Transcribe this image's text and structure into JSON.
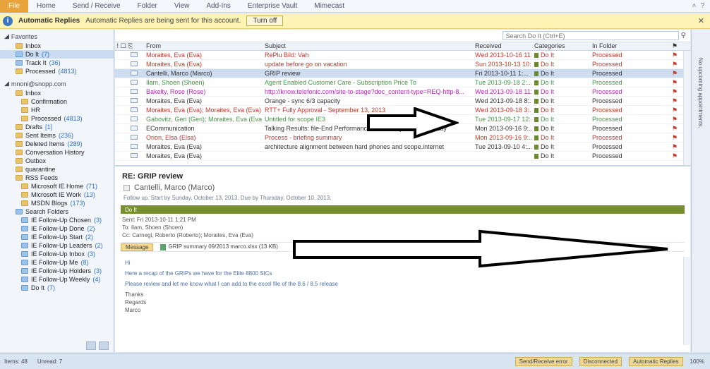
{
  "ribbon": {
    "file": "File",
    "tabs": [
      "Home",
      "Send / Receive",
      "Folder",
      "View",
      "Add-Ins",
      "Enterprise Vault",
      "Mimecast"
    ]
  },
  "notice": {
    "title": "Automatic Replies",
    "text": "Automatic Replies are being sent for this account.",
    "button": "Turn off"
  },
  "nav": {
    "favorites_header": "Favorites",
    "favorites": [
      {
        "label": "Inbox",
        "count": ""
      },
      {
        "label": "Do It",
        "count": "(7)"
      },
      {
        "label": "Track It",
        "count": "(36)"
      },
      {
        "label": "Processed",
        "count": "(4813)"
      }
    ],
    "account_header": "mnoni@snopp.com",
    "account_items": [
      {
        "label": "Inbox",
        "count": "",
        "level": 1
      },
      {
        "label": "Confirmation",
        "count": "",
        "level": 2
      },
      {
        "label": "HR",
        "count": "",
        "level": 2
      },
      {
        "label": "Processed",
        "count": "(4813)",
        "level": 2
      },
      {
        "label": "Drafts",
        "count": "[1]",
        "level": 1
      },
      {
        "label": "Sent Items",
        "count": "(236)",
        "level": 1
      },
      {
        "label": "Deleted Items",
        "count": "(289)",
        "level": 1
      },
      {
        "label": "Conversation History",
        "count": "",
        "level": 1
      },
      {
        "label": "Outbox",
        "count": "",
        "level": 1
      },
      {
        "label": "quarantine",
        "count": "",
        "level": 1
      },
      {
        "label": "RSS Feeds",
        "count": "",
        "level": 1
      },
      {
        "label": "Microsoft IE Home",
        "count": "(71)",
        "level": 2
      },
      {
        "label": "Microsoft IE Work",
        "count": "(13)",
        "level": 2
      },
      {
        "label": "MSDN Blogs",
        "count": "(173)",
        "level": 2
      },
      {
        "label": "Search Folders",
        "count": "",
        "level": 1
      },
      {
        "label": "IE Follow-Up Chosen",
        "count": "(3)",
        "level": 2
      },
      {
        "label": "IE Follow-Up Done",
        "count": "(2)",
        "level": 2
      },
      {
        "label": "IE Follow-Up Start",
        "count": "(2)",
        "level": 2
      },
      {
        "label": "IE Follow-Up Leaders",
        "count": "(2)",
        "level": 2
      },
      {
        "label": "IE Follow-Up Inbox",
        "count": "(3)",
        "level": 2
      },
      {
        "label": "IE Follow-Up Me",
        "count": "(8)",
        "level": 2
      },
      {
        "label": "IE Follow-Up Holders",
        "count": "(3)",
        "level": 2
      },
      {
        "label": "IE Follow-Up Weekly",
        "count": "(4)",
        "level": 2
      },
      {
        "label": "Do It",
        "count": "(7)",
        "level": 2
      }
    ]
  },
  "search": {
    "placeholder": "Search Do It (Ctrl+E)"
  },
  "list": {
    "headers": {
      "from": "From",
      "subject": "Subject",
      "received": "Received",
      "categories": "Categories",
      "folder": "In Folder"
    },
    "rows": [
      {
        "from": "Moraites, Eva (Eva)",
        "subject": "RePlu Bild: Vah",
        "received": "Wed 2013-10-16 11:...",
        "category": "Do It",
        "folder": "Processed",
        "color": "#c0392b"
      },
      {
        "from": "Moraites, Eva (Eva)",
        "subject": "update before go on vacation",
        "received": "Sun 2013-10-13 10:...",
        "category": "Do It",
        "folder": "Processed",
        "color": "#c0392b"
      },
      {
        "from": "Cantelli, Marco (Marco)",
        "subject": "GRIP review",
        "received": "Fri 2013-10-11 1:...",
        "category": "Do It",
        "folder": "Processed",
        "color": "#333333",
        "selected": true
      },
      {
        "from": "Ilam, Shoen (Shoen)",
        "subject": "Agent Enabled Customer Care - Subscription Price To",
        "received": "Tue 2013-09-18 2:...",
        "category": "Do It",
        "folder": "Processed",
        "color": "#3a9b45"
      },
      {
        "from": "Bakelty, Rose (Rose)",
        "subject": "http://know.telefonic.com/site-to-stage?doc_content-type=REQ-http-8...",
        "received": "Wed 2013-09-18 11:...",
        "category": "Do It",
        "folder": "Processed",
        "color": "#b32cb0"
      },
      {
        "from": "Moraites, Eva (Eva)",
        "subject": "Orange - sync 6/3 capacity",
        "received": "Wed 2013-09-18 8:...",
        "category": "Do It",
        "folder": "Processed",
        "color": "#333333"
      },
      {
        "from": "Moraites, Eva (Eva); Moraites, Eva (Eva)",
        "subject": "RTT+ Fully Approval - September 13, 2013",
        "received": "Wed 2013-09-18 3:...",
        "category": "Do It",
        "folder": "Processed",
        "color": "#c0392b"
      },
      {
        "from": "Gabovitz, Geri (Geri); Moraites, Eva (Eva)",
        "subject": "Untitled for scope IE3",
        "received": "Tue 2013-09-17 12:...",
        "category": "Do It",
        "folder": "Processed",
        "color": "#3a9b45"
      },
      {
        "from": "ECommunication",
        "subject": "Talking Results: file-End Performance Review Cycle Open Today",
        "received": "Mon 2013-09-16 9:...",
        "category": "Do It",
        "folder": "Processed",
        "color": "#333333"
      },
      {
        "from": "Orion, Elsa (Elsa)",
        "subject": "Process - briefing summary",
        "received": "Mon 2013-09-16 9:...",
        "category": "Do It",
        "folder": "Processed",
        "color": "#c0392b"
      },
      {
        "from": "Moraites, Eva (Eva)",
        "subject": "architecture alignment between hard phones and scope.internet",
        "received": "Tue 2013-09-10 4:...",
        "category": "Do It",
        "folder": "Processed",
        "color": "#333333"
      },
      {
        "from": "Moraites, Eva (Eva)",
        "subject": "",
        "received": "",
        "category": "Do It",
        "folder": "Processed",
        "color": "#333333"
      }
    ]
  },
  "reading": {
    "subject": "RE: GRIP review",
    "sender": "Cantelli, Marco (Marco)",
    "followup": "Follow up. Start by Sunday, October 13, 2013. Due by Thursday, October 10, 2013.",
    "category": "Do It",
    "sent_label": "Sent:",
    "sent": "Fri 2013-10-11 1:21 PM",
    "to_label": "To:",
    "to": "Ilam, Shoen (Shoen)",
    "cc_label": "Cc:",
    "cc": "Carnegi, Roberto (Roberto); Moraites, Eva (Eva)",
    "message_btn": "Message",
    "attachment": "GRIP summary 09/2013 marco.xlsx (13 KB)",
    "body": [
      "Hi",
      "Here a recap of the GRIPs we have for the Elite 8800 SICs",
      "Please review and let me know what I can add to the excel file of the 8.6 / 8.5 release"
    ],
    "signature": [
      "Thanks",
      "Regards",
      "Marco"
    ]
  },
  "rail": {
    "text": "No upcoming appointments."
  },
  "status": {
    "items": "Items: 48",
    "unread": "Unread: 7",
    "right": [
      "Send/Receive error",
      "Disconnected",
      "Automatic Replies"
    ],
    "zoom": "100%"
  }
}
